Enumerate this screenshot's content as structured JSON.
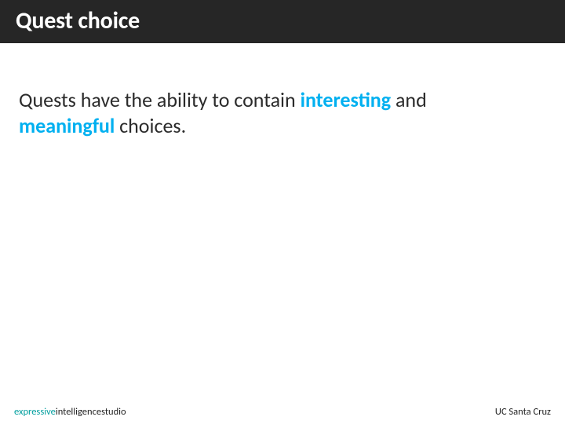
{
  "title": "Quest choice",
  "body": {
    "t1": "Quests have the ability to contain ",
    "h1": "interesting",
    "t2": " and ",
    "h2": "meaningful",
    "t3": " choices."
  },
  "footer": {
    "eis_e": "expressive",
    "eis_i": "intelligence",
    "eis_s": "studio",
    "right": "UC Santa Cruz"
  }
}
